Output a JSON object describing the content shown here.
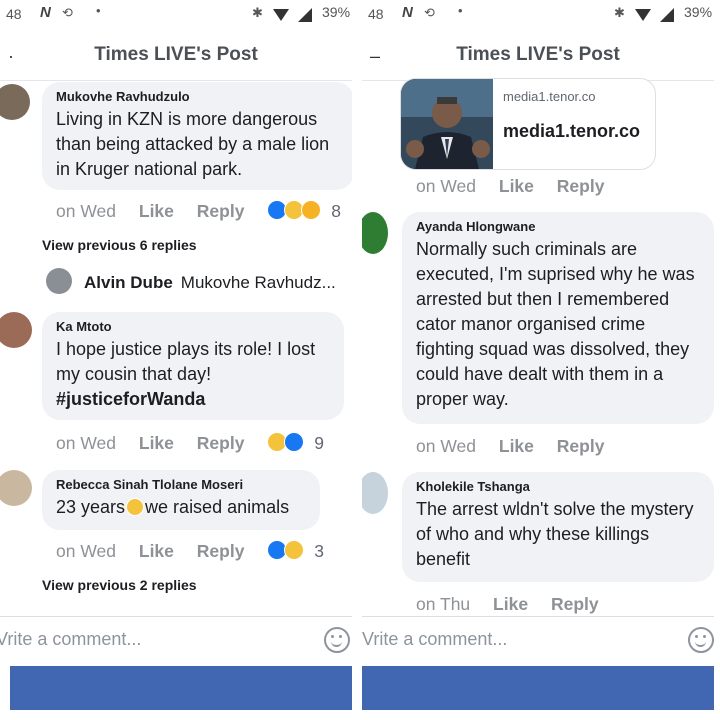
{
  "left": {
    "status": {
      "time": "48",
      "battery": "39%"
    },
    "header": {
      "title": "Times LIVE's Post"
    },
    "comments": [
      {
        "name": "Mukovhe Ravhudzulo",
        "text": "Living in KZN is more dangerous than being attacked by a male lion in Kruger national park.",
        "when": "on Wed",
        "like": "Like",
        "reply": "Reply",
        "count": "8"
      },
      {
        "name": "Ka Mtoto",
        "text": "I hope justice plays its role! I lost my cousin that day!",
        "hashtag": "#justiceforWanda",
        "when": "on Wed",
        "like": "Like",
        "reply": "Reply",
        "count": "9"
      },
      {
        "name": "Rebecca Sinah Tlolane Moseri",
        "text_a": "23 years",
        "text_b": "we raised animals",
        "when": "on Wed",
        "like": "Like",
        "reply": "Reply",
        "count": "3"
      }
    ],
    "view_prev_1": "View previous 6 replies",
    "reply_preview": {
      "name": "Alvin Dube",
      "text": "Mukovhe Ravhudz..."
    },
    "view_prev_2": "View previous 2 replies",
    "composer": {
      "placeholder": "Vrite a comment..."
    }
  },
  "right": {
    "status": {
      "time": "48",
      "battery": "39%"
    },
    "header": {
      "title": "Times LIVE's Post"
    },
    "link": {
      "domain": "media1.tenor.co",
      "title": "media1.tenor.co",
      "when": "on Wed",
      "like": "Like",
      "reply": "Reply"
    },
    "comments": [
      {
        "name": "Ayanda Hlongwane",
        "text": "Normally such criminals are executed, I'm suprised why he was arrested but then I remembered cator manor organised crime fighting squad was dissolved, they could have dealt with them in a proper way.",
        "when": "on Wed",
        "like": "Like",
        "reply": "Reply"
      },
      {
        "name": "Kholekile Tshanga",
        "text": "The arrest wldn't solve the mystery of who and why these killings benefit",
        "when": "on Thu",
        "like": "Like",
        "reply": "Reply"
      }
    ],
    "composer": {
      "placeholder": "Vrite a comment..."
    }
  },
  "colors": {
    "brand_blue": "#4267b2",
    "bubble_gray": "#f0f2f5",
    "meta_gray": "#8e9196"
  }
}
